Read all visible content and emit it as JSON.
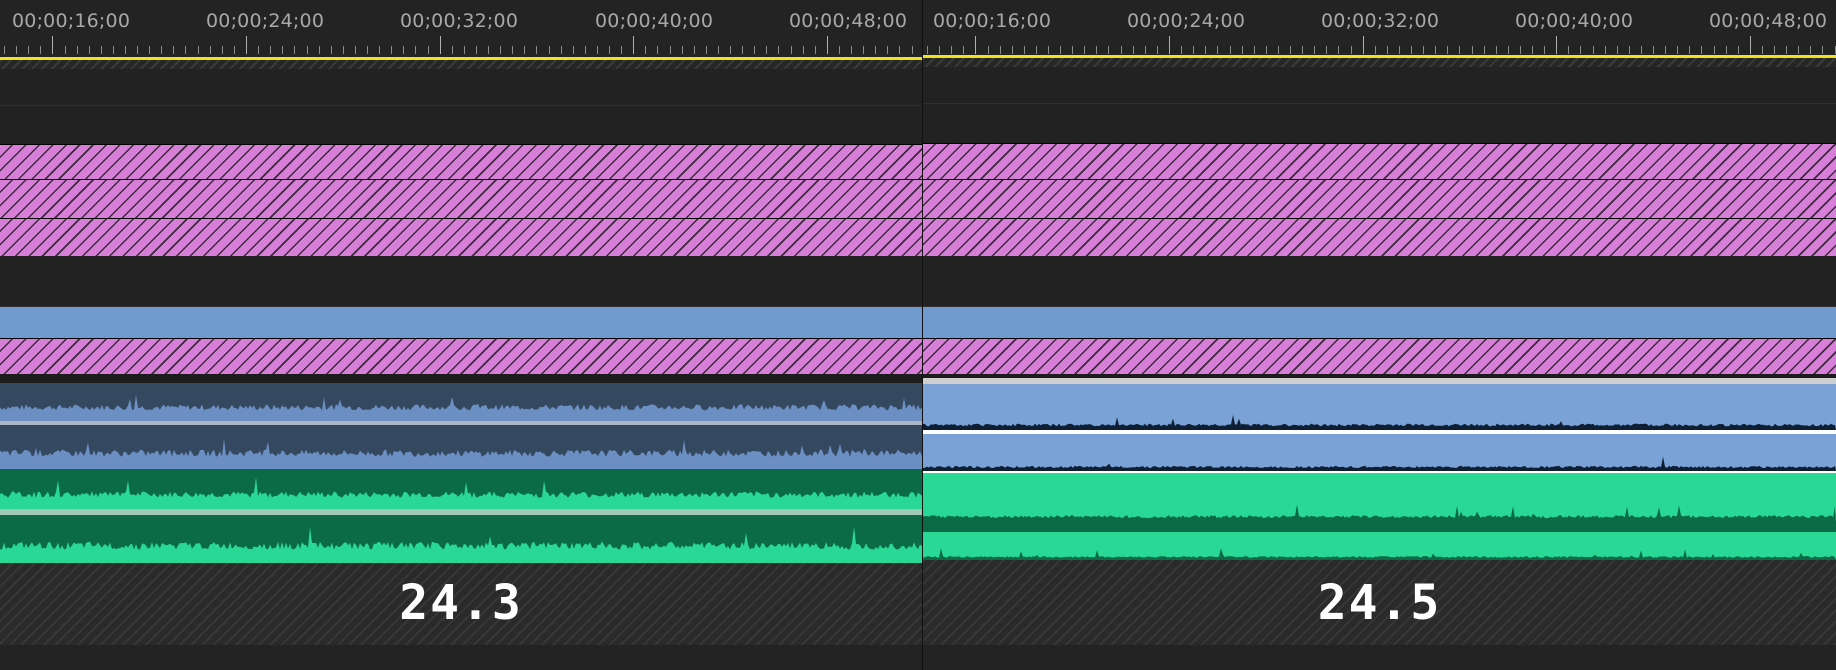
{
  "comparison": {
    "left": {
      "version_label": "24.3",
      "timecodes": [
        "00;00;16;00",
        "00;00;24;00",
        "00;00;32;00",
        "00;00;40;00",
        "00;00;48;00"
      ]
    },
    "right": {
      "version_label": "24.5",
      "timecodes": [
        "00;00;16;00",
        "00;00;24;00",
        "00;00;32;00",
        "00;00;40;00",
        "00;00;48;00"
      ]
    }
  },
  "colors": {
    "background": "#1f1f1f",
    "playhead_bar": "#f2e21b",
    "video_clip_pink": "#d67ed8",
    "video_clip_blue": "#6f9ad0",
    "audio_blue_bg_old": "#34485f",
    "audio_blue_wave_old": "#6b8fc2",
    "audio_green_bg_old": "#0b6b46",
    "audio_green_wave_old": "#2ad896",
    "audio_blue_bg_new": "#7aa2d6",
    "audio_blue_wave_new": "#0e1e33",
    "audio_green_bg_new": "#2ad896",
    "audio_green_wave_new": "#0b6b46"
  }
}
